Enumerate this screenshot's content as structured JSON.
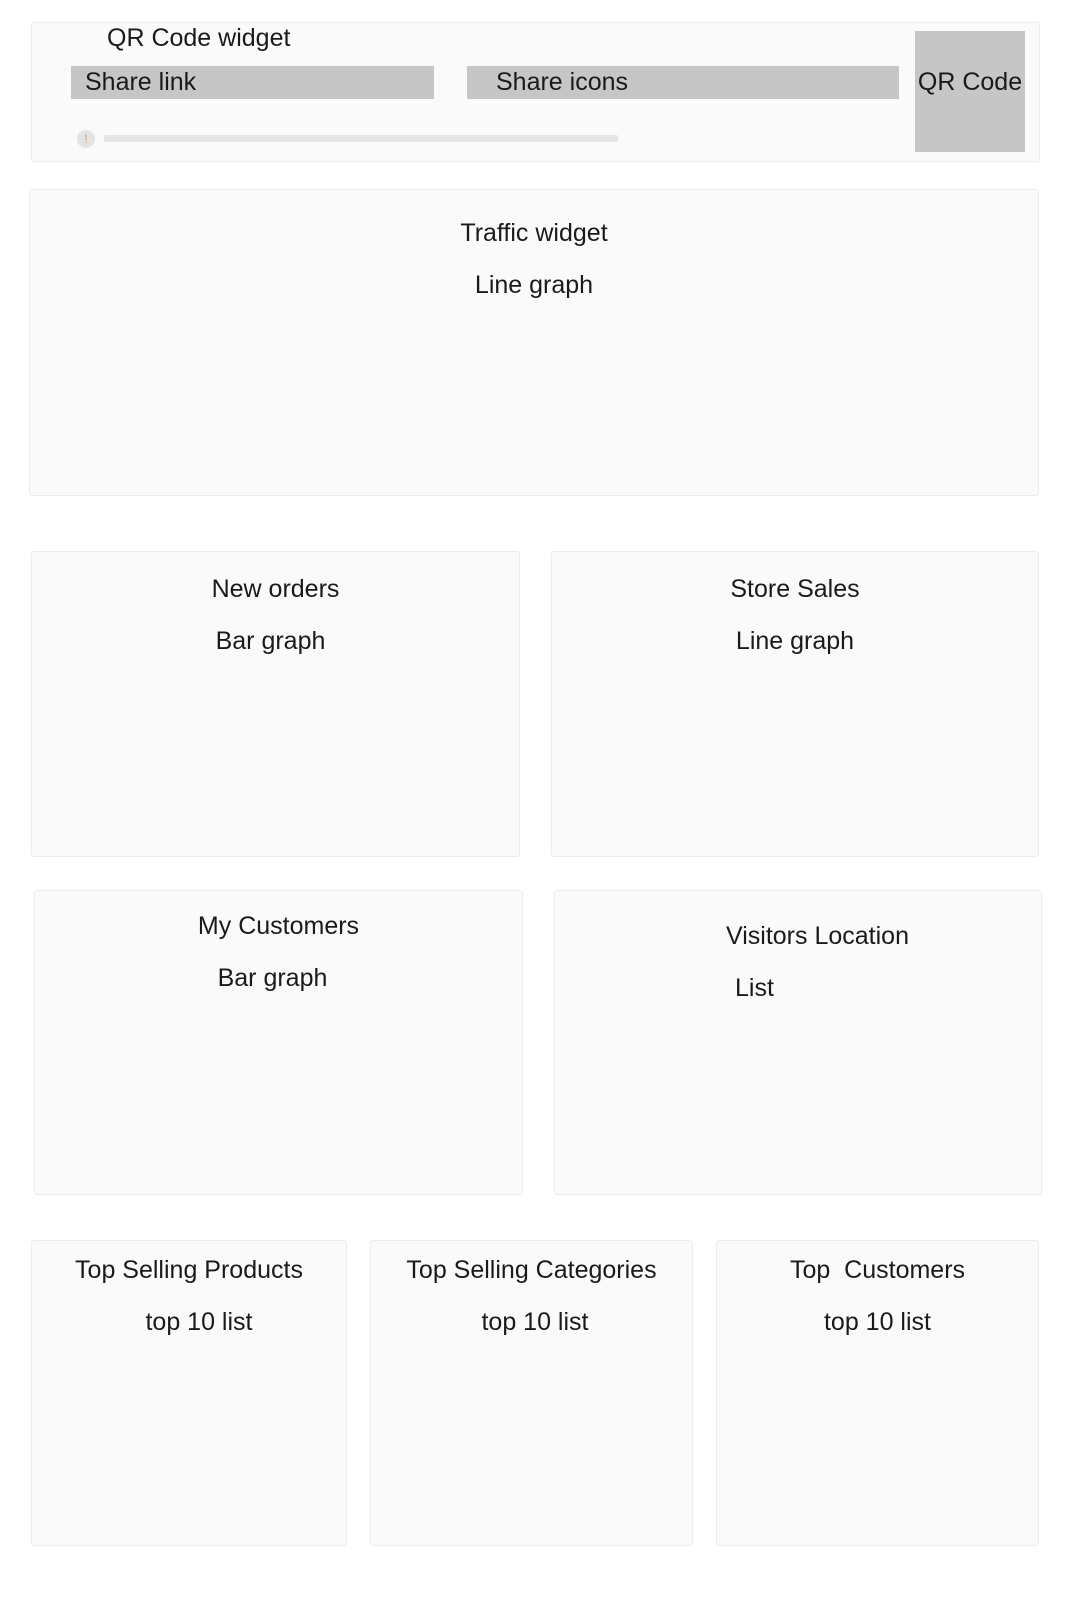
{
  "qr_widget": {
    "title": "QR Code widget",
    "share_link_label": "Share link",
    "share_icons_label": "Share icons",
    "qr_code_label": "QR Code",
    "progress_icon": "info-dot-icon",
    "progress_fraction": 0.0
  },
  "traffic_widget": {
    "title": "Traffic widget",
    "subtitle": "Line graph"
  },
  "new_orders_widget": {
    "title": "New orders",
    "subtitle": "Bar graph"
  },
  "store_sales_widget": {
    "title": "Store Sales",
    "subtitle": "Line graph"
  },
  "my_customers_widget": {
    "title": "My Customers",
    "subtitle": "Bar graph"
  },
  "visitors_location_widget": {
    "title": "Visitors Location",
    "subtitle": "List"
  },
  "top_selling_products_widget": {
    "title": "Top Selling Products",
    "subtitle": "top 10 list"
  },
  "top_selling_categories_widget": {
    "title": "Top Selling Categories",
    "subtitle": "top 10 list"
  },
  "top_customers_widget": {
    "title": "Top  Customers",
    "subtitle": "top 10 list"
  },
  "colors": {
    "card_background": "#fafafa",
    "card_border": "#ececec",
    "placeholder_gray": "#c6c6c6"
  }
}
